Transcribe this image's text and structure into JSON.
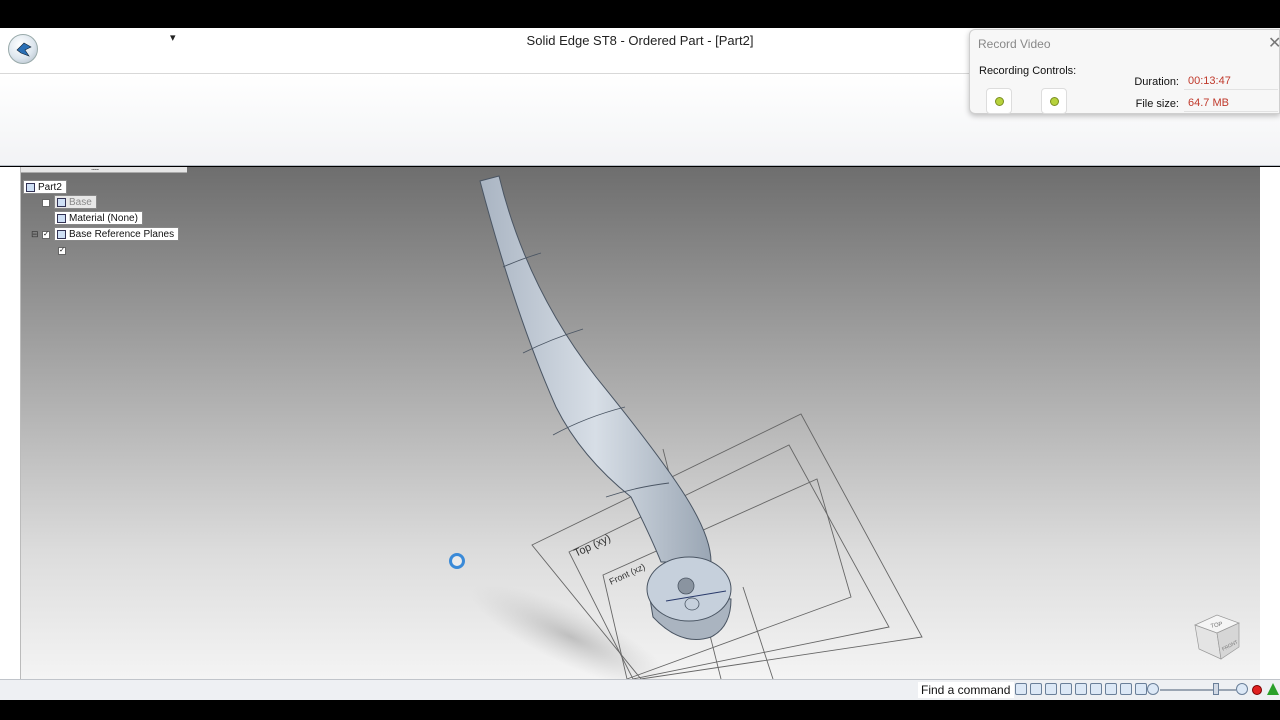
{
  "window": {
    "title": "Solid Edge ST8 - Ordered Part - [Part2]",
    "qat_menu_glyph": "▾"
  },
  "pathfinder": {
    "root": "Part2",
    "items": [
      {
        "label": "Base",
        "state": "dim"
      },
      {
        "label": "Material (None)"
      },
      {
        "label": "Base Reference Planes",
        "checked": true
      }
    ]
  },
  "model": {
    "plane_labels": [
      "Top (xy)",
      "Front (xz)"
    ],
    "view_cube": {
      "face_top": "TOP",
      "face_front": "FRONT"
    }
  },
  "statusbar": {
    "find_command": "Find a command"
  },
  "record_video": {
    "title": "Record Video",
    "controls_label": "Recording Controls:",
    "duration_label": "Duration:",
    "duration_value": "00:13:47",
    "filesize_label": "File size:",
    "filesize_value": "64.7 MB",
    "close_glyph": "✕"
  },
  "colors": {
    "accent_red": "#c0392b",
    "record_button_green": "#b7d23c",
    "part_body": "#c6d0dc"
  }
}
